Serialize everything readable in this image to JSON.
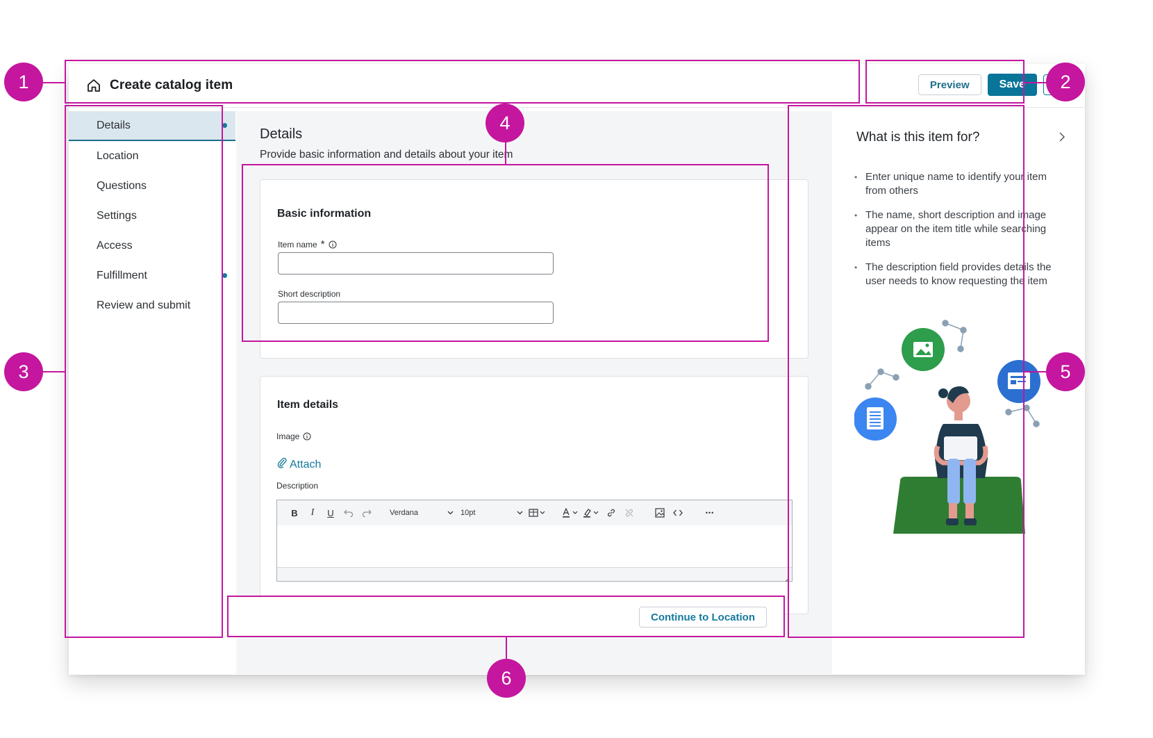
{
  "header": {
    "title": "Create catalog item",
    "preview_label": "Preview",
    "save_label": "Save",
    "more_label": "⋮"
  },
  "nav": {
    "items": [
      {
        "label": "Details",
        "active": true,
        "dot": true
      },
      {
        "label": "Location",
        "active": false,
        "dot": false
      },
      {
        "label": "Questions",
        "active": false,
        "dot": false
      },
      {
        "label": "Settings",
        "active": false,
        "dot": false
      },
      {
        "label": "Access",
        "active": false,
        "dot": false
      },
      {
        "label": "Fulfillment",
        "active": false,
        "dot": true
      },
      {
        "label": "Review and submit",
        "active": false,
        "dot": false
      }
    ]
  },
  "main": {
    "title": "Details",
    "subtitle": "Provide basic information and details about your item",
    "basic": {
      "title": "Basic information",
      "item_name_label": "Item name",
      "item_name_required": "*",
      "item_name_value": "",
      "short_desc_label": "Short description",
      "short_desc_value": ""
    },
    "details": {
      "title": "Item details",
      "image_label": "Image",
      "attach_label": "Attach",
      "description_label": "Description",
      "toolbar": {
        "bold": "B",
        "italic": "I",
        "underline": "U",
        "font": "Verdana",
        "size": "10pt",
        "more": "•••"
      }
    },
    "continue_label": "Continue to Location"
  },
  "help": {
    "title": "What is this item for?",
    "items": [
      "Enter unique name to identify your item from others",
      "The name, short description and image appear on the item title while searching items",
      "The description field provides details the user needs to know requesting the item"
    ]
  },
  "annotations": [
    "1",
    "2",
    "3",
    "4",
    "5",
    "6"
  ],
  "colors": {
    "accent": "#087599",
    "annotation": "#c4169e",
    "active_nav_bg": "#dbe7ee",
    "illustration_green": "#2f7d32"
  }
}
